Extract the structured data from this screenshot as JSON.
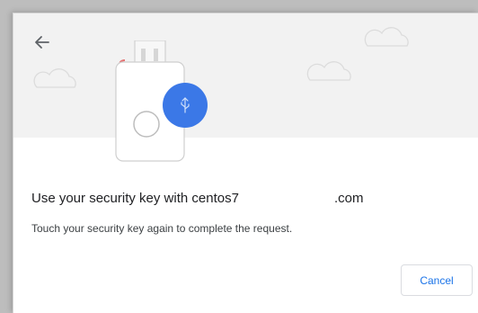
{
  "dialog": {
    "back_icon": "arrow-left-icon",
    "illustration_icon": "security-key-usb-icon",
    "title_prefix": "Use your security key with centos7",
    "title_suffix": ".com",
    "subtitle": "Touch your security key again to complete the request.",
    "cancel_label": "Cancel"
  },
  "colors": {
    "banner": "#f2f2f2",
    "accent": "#1a73e8",
    "usb_badge": "#3b78e7"
  }
}
